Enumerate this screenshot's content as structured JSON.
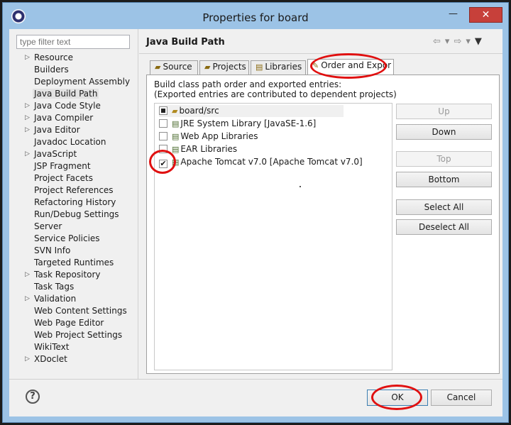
{
  "window": {
    "title": "Properties for board",
    "minimize": "—",
    "maximize": "□",
    "close": "✕"
  },
  "filter": {
    "placeholder": "type filter text"
  },
  "tree": [
    {
      "label": "Resource",
      "expandable": true
    },
    {
      "label": "Builders",
      "expandable": false
    },
    {
      "label": "Deployment Assembly",
      "expandable": false
    },
    {
      "label": "Java Build Path",
      "expandable": false,
      "selected": true
    },
    {
      "label": "Java Code Style",
      "expandable": true
    },
    {
      "label": "Java Compiler",
      "expandable": true
    },
    {
      "label": "Java Editor",
      "expandable": true
    },
    {
      "label": "Javadoc Location",
      "expandable": false
    },
    {
      "label": "JavaScript",
      "expandable": true
    },
    {
      "label": "JSP Fragment",
      "expandable": false
    },
    {
      "label": "Project Facets",
      "expandable": false
    },
    {
      "label": "Project References",
      "expandable": false
    },
    {
      "label": "Refactoring History",
      "expandable": false
    },
    {
      "label": "Run/Debug Settings",
      "expandable": false
    },
    {
      "label": "Server",
      "expandable": false
    },
    {
      "label": "Service Policies",
      "expandable": false
    },
    {
      "label": "SVN Info",
      "expandable": false
    },
    {
      "label": "Targeted Runtimes",
      "expandable": false
    },
    {
      "label": "Task Repository",
      "expandable": true
    },
    {
      "label": "Task Tags",
      "expandable": false
    },
    {
      "label": "Validation",
      "expandable": true
    },
    {
      "label": "Web Content Settings",
      "expandable": false
    },
    {
      "label": "Web Page Editor",
      "expandable": false
    },
    {
      "label": "Web Project Settings",
      "expandable": false
    },
    {
      "label": "WikiText",
      "expandable": false
    },
    {
      "label": "XDoclet",
      "expandable": true
    }
  ],
  "page": {
    "title": "Java Build Path",
    "tabs": {
      "source": "Source",
      "projects": "Projects",
      "libraries": "Libraries",
      "order": "Order and Expor"
    },
    "desc1": "Build class path order and exported entries:",
    "desc2": "(Exported entries are contributed to dependent projects)",
    "entries": [
      {
        "label": "board/src",
        "state": "partial"
      },
      {
        "label": "JRE System Library [JavaSE-1.6]",
        "state": "unchecked"
      },
      {
        "label": "Web App Libraries",
        "state": "unchecked"
      },
      {
        "label": "EAR Libraries",
        "state": "unchecked"
      },
      {
        "label": "Apache Tomcat v7.0 [Apache Tomcat v7.0]",
        "state": "checked",
        "mark": "✔"
      }
    ],
    "buttons": {
      "up": "Up",
      "down": "Down",
      "top": "Top",
      "bottom": "Bottom",
      "select_all": "Select All",
      "deselect_all": "Deselect All"
    }
  },
  "footer": {
    "help": "?",
    "ok": "OK",
    "cancel": "Cancel"
  },
  "colors": {
    "title_bar": "#9cc3e6",
    "close_button": "#c7403a",
    "annotation": "#e01010"
  }
}
